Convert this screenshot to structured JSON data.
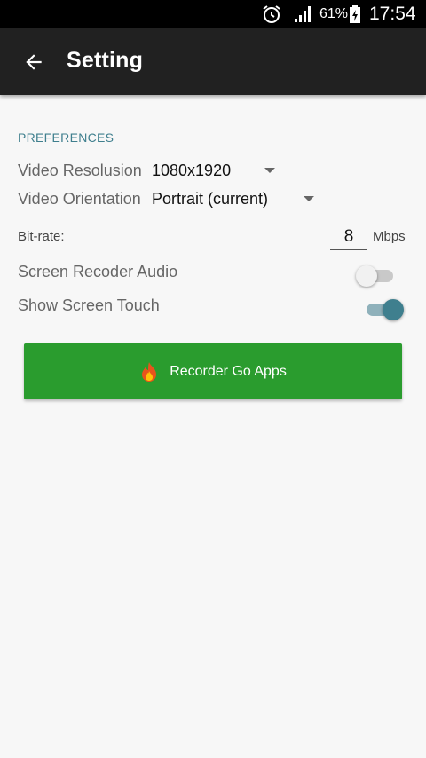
{
  "status_bar": {
    "battery_percent": "61%",
    "time": "17:54",
    "icons": [
      "alarm-icon",
      "signal-icon",
      "battery-charging-icon"
    ]
  },
  "app_bar": {
    "title": "Setting",
    "back_icon": "arrow-left-icon"
  },
  "preferences": {
    "header": "PREFERENCES",
    "video_resolution": {
      "label": "Video Resolusion",
      "value": "1080x1920"
    },
    "video_orientation": {
      "label": "Video Orientation",
      "value": "Portrait (current)"
    },
    "bitrate": {
      "label": "Bit-rate:",
      "value": "8",
      "unit": "Mbps"
    },
    "screen_recorder_audio": {
      "label": "Screen Recoder Audio",
      "enabled": false
    },
    "show_screen_touch": {
      "label": "Show Screen Touch",
      "enabled": true
    }
  },
  "promo_button": {
    "label": "Recorder Go Apps",
    "icon": "fire-icon",
    "color": "#2a9c2e"
  },
  "colors": {
    "accent": "#3f7f8e",
    "app_bar": "#212121",
    "background": "#f7f7f7"
  }
}
